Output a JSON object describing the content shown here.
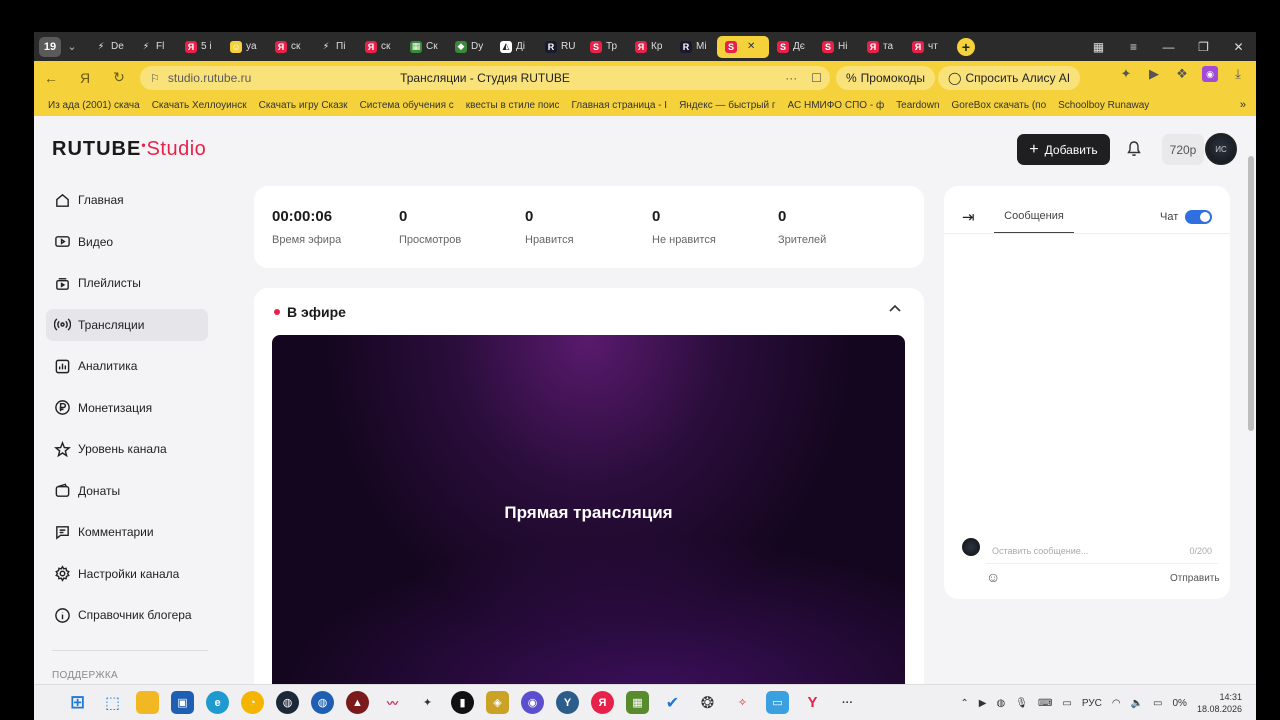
{
  "browser": {
    "tab_count": "19",
    "tabs": [
      {
        "label": "De",
        "color": "#2b2b2b",
        "glyph": "⚡"
      },
      {
        "label": "Fl",
        "color": "#2b2b2b",
        "glyph": "⚡"
      },
      {
        "label": "5 i",
        "color": "#e8214a",
        "glyph": "Я"
      },
      {
        "label": "ya",
        "color": "#f5d23c",
        "glyph": "☺"
      },
      {
        "label": "ск",
        "color": "#e8214a",
        "glyph": "Я"
      },
      {
        "label": "Пі",
        "color": "#2b2b2b",
        "glyph": "⚡"
      },
      {
        "label": "ск",
        "color": "#e8214a",
        "glyph": "Я"
      },
      {
        "label": "Ск",
        "color": "#3a8a3a",
        "glyph": "▦"
      },
      {
        "label": "Dy",
        "color": "#3a8a3a",
        "glyph": "◆"
      },
      {
        "label": "Ді",
        "color": "#ffffff",
        "glyph": "◭"
      },
      {
        "label": "RU",
        "color": "#1a1a2e",
        "glyph": "R"
      },
      {
        "label": "Тр",
        "color": "#e8214a",
        "glyph": "S"
      },
      {
        "label": "Кр",
        "color": "#e8214a",
        "glyph": "Я"
      },
      {
        "label": "Мі",
        "color": "#1a1a2e",
        "glyph": "R"
      },
      {
        "label": "",
        "color": "#e8214a",
        "glyph": "S",
        "active": true
      },
      {
        "label": "Дє",
        "color": "#e8214a",
        "glyph": "S"
      },
      {
        "label": "Ні",
        "color": "#e8214a",
        "glyph": "S"
      },
      {
        "label": "та",
        "color": "#e8214a",
        "glyph": "Я"
      },
      {
        "label": "чт",
        "color": "#e8214a",
        "glyph": "Я"
      }
    ],
    "url": "studio.rutube.ru",
    "page_title": "Трансляции - Студия RUTUBE",
    "promo_label": "Промокоды",
    "alice_label": "Спросить Алису AI",
    "bookmarks": [
      "Из ада (2001) скача",
      "Скачать Хеллоуинск",
      "Скачать игру Сказк",
      "Система обучения с",
      "квесты в стиле поис",
      "Главная страница - I",
      "Яндекс — быстрый г",
      "АС НМИФО СПО - ф",
      "Teardown",
      "GoreBox скачать (по",
      "Schoolboy Runaway"
    ]
  },
  "header": {
    "logo_main": "RUTUBE",
    "logo_studio": "Studio",
    "add_label": "Добавить",
    "quality_label": "720p",
    "avatar_text": "ИС"
  },
  "sidebar": {
    "items": [
      {
        "label": "Главная",
        "icon": "home-icon"
      },
      {
        "label": "Видео",
        "icon": "video-icon"
      },
      {
        "label": "Плейлисты",
        "icon": "playlist-icon"
      },
      {
        "label": "Трансляции",
        "icon": "broadcast-icon",
        "active": true
      },
      {
        "label": "Аналитика",
        "icon": "analytics-icon"
      },
      {
        "label": "Монетизация",
        "icon": "ruble-icon"
      },
      {
        "label": "Уровень канала",
        "icon": "star-icon"
      },
      {
        "label": "Донаты",
        "icon": "wallet-icon"
      },
      {
        "label": "Комментарии",
        "icon": "comment-icon"
      },
      {
        "label": "Настройки канала",
        "icon": "gear-icon"
      },
      {
        "label": "Справочник блогера",
        "icon": "info-icon"
      }
    ],
    "support_label": "ПОДДЕРЖКА"
  },
  "stats": [
    {
      "value": "00:00:06",
      "label": "Время эфира"
    },
    {
      "value": "0",
      "label": "Просмотров"
    },
    {
      "value": "0",
      "label": "Нравится"
    },
    {
      "value": "0",
      "label": "Не нравится"
    },
    {
      "value": "0",
      "label": "Зрителей"
    }
  ],
  "live": {
    "title": "В эфире",
    "player_text": "Прямая трансляция"
  },
  "chat": {
    "tab_label": "Сообщения",
    "toggle_label": "Чат",
    "input_placeholder": "Оставить сообщение...",
    "counter": "0/200",
    "send_label": "Отправить"
  },
  "taskbar": {
    "lang": "РУС",
    "battery": "0%",
    "time": "14:31",
    "date": "18.08.2026"
  }
}
